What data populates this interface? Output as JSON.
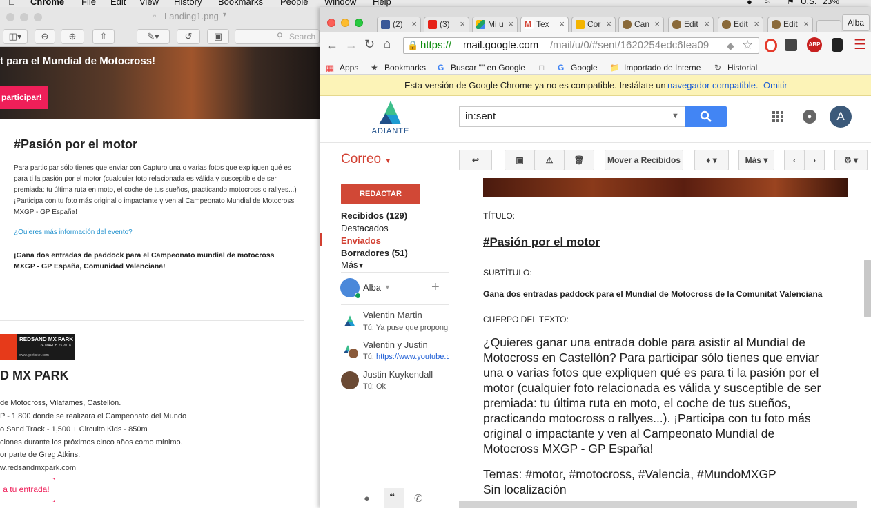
{
  "menubar": {
    "app": "Chrome",
    "items": [
      "File",
      "Edit",
      "View",
      "History",
      "Bookmarks",
      "People",
      "Window",
      "Help"
    ],
    "status_locale": "U.S.",
    "battery": "23%"
  },
  "preview": {
    "file_title": "Landing1.png",
    "search_placeholder": "Search",
    "banner_title": "t para el Mundial de Motocross!",
    "banner_button": "participar!",
    "heading": "#Pasión por el motor",
    "paragraph": "Para participar sólo tienes que enviar con Capturo una o varias fotos que expliquen qué es para ti la pasión por el motor (cualquier foto relacionada es válida y susceptible de ser premiada: tu última ruta en moto, el coche de tus sueños, practicando motocross o rallyes...) ¡Participa con tu foto más original o impactante y ven al Campeonato Mundial de Motocross MXGP - GP España!",
    "more_info_link": "¿Quieres más información del evento?",
    "prize": "¡Gana dos entradas de paddock para el Campeonato mundial de motocross MXGP -  GP España, Comunidad Valenciana!",
    "ad_title": "REDSAND MX PARK",
    "ad_dates": "24 MARCH 25 2018",
    "ad_site": "www.goeticket.com",
    "park_heading": "D MX PARK",
    "park_lines": [
      "de Motocross, Vilafamés, Castellón.",
      "P - 1,800 donde se realizara el Campeonato del Mundo",
      "o Sand Track - 1,500 + Circuito Kids - 850m",
      "ciones durante los próximos cinco años como mínimo.",
      "or parte de Greg Atkins.",
      "w.redsandmxpark.com"
    ],
    "ticket_button": "a tu entrada!"
  },
  "chrome": {
    "tabs": [
      {
        "label": "(2)",
        "color": "#3b5998"
      },
      {
        "label": "(3)",
        "color": "#e62117"
      },
      {
        "label": "Mi u",
        "color": "#1fa463"
      },
      {
        "label": "Tex",
        "color": "#d44638"
      },
      {
        "label": "Cor",
        "color": "#f4b400"
      },
      {
        "label": "Can",
        "color": "#8a6a3a"
      },
      {
        "label": "Edit",
        "color": "#8a6a3a"
      },
      {
        "label": "Edit",
        "color": "#8a6a3a"
      },
      {
        "label": "Edit",
        "color": "#8a6a3a"
      }
    ],
    "profile": "Alba",
    "url_scheme": "https://",
    "url_host": "mail.google.com",
    "url_path": "/mail/u/0/#sent/1620254edc6fea09",
    "bookmarks": [
      "Apps",
      "Bookmarks",
      "Buscar \"\" en Google",
      "Google",
      "Importado de Interne",
      "Historial"
    ],
    "infobar_text": "Esta versión de Google Chrome ya no es compatible. Instálate un",
    "infobar_link": "navegador compatible.",
    "infobar_dismiss": "Omitir"
  },
  "gmail": {
    "logo_text": "ADIANTE",
    "search_value": "in:sent",
    "avatar_letter": "A",
    "mail_label": "Correo",
    "compose": "REDACTAR",
    "move_to_inbox": "Mover a Recibidos",
    "more": "Más",
    "nav": {
      "inbox": "Recibidos (129)",
      "starred": "Destacados",
      "sent": "Enviados",
      "drafts": "Borradores (51)",
      "more": "Más"
    },
    "hangouts_user": "Alba",
    "hangouts": [
      {
        "name": "Valentin Martin",
        "msg": "Tú: Ya puse que propong"
      },
      {
        "name": "Valentin y Justin",
        "msg_prefix": "Tú: ",
        "msg_link": "https://www.youtube.c"
      },
      {
        "name": "Justin Kuykendall",
        "msg": "Tú: Ok"
      }
    ],
    "message": {
      "title_label": "TÍTULO:",
      "title": "#Pasión por el motor",
      "subtitle_label": "SUBTÍTULO:",
      "subtitle": "Gana dos entradas paddock para el Mundial de Motocross de la Comunitat Valenciana",
      "body_label": "CUERPO DEL TEXTO:",
      "body_lines": [
        "¿Quieres ganar una entrada doble para asistir al Mundial de",
        "Motocross en Castellón? Para participar sólo tienes que enviar",
        "una o varias fotos que expliquen qué es para ti la pasión por el",
        "motor (cualquier foto relacionada es válida y susceptible de ser",
        "premiada: tu última ruta en moto, el coche de tus sueños,",
        "practicando motocross o rallyes...). ¡Participa con tu foto más",
        "original o impactante y ven al Campeonato Mundial de",
        "Motocross MXGP - GP España!"
      ],
      "tags": "Temas: #motor, #motocross, #Valencia, #MundoMXGP",
      "location": "Sin localización"
    }
  }
}
